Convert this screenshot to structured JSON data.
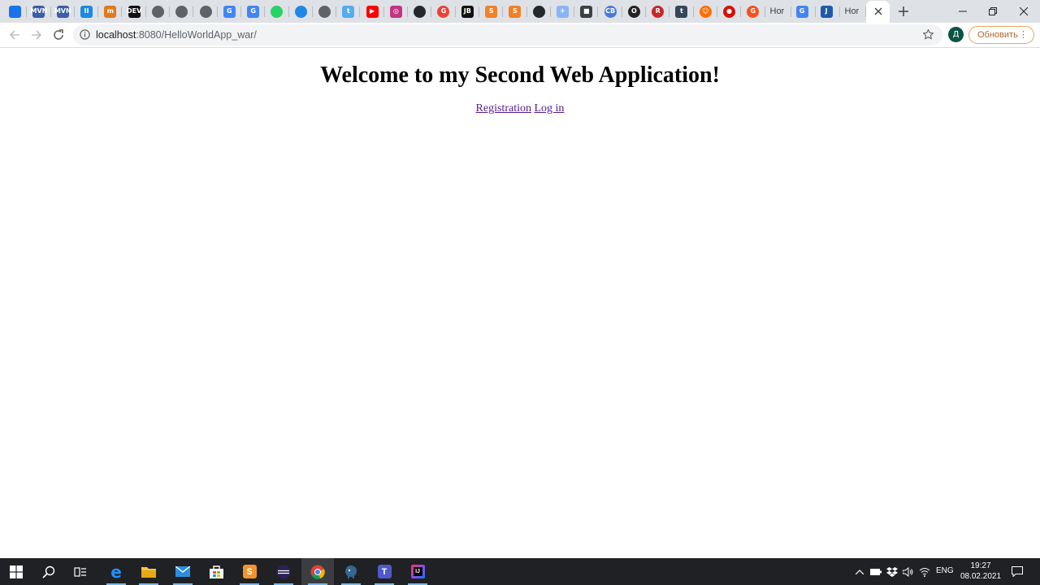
{
  "pinned_tabs": [
    {
      "name": "chat",
      "glyph": "",
      "color": "#1a73e8",
      "round": false
    },
    {
      "name": "mvn",
      "glyph": "MVN",
      "color": "#3b5ea8",
      "round": false
    },
    {
      "name": "mvn-2",
      "glyph": "MVN",
      "color": "#3b5ea8",
      "round": false
    },
    {
      "name": "tabs",
      "glyph": "II",
      "color": "#1e88e5",
      "round": false
    },
    {
      "name": "home",
      "glyph": "m",
      "color": "#e07a1f",
      "round": false
    },
    {
      "name": "dev",
      "glyph": "DEV",
      "color": "#111111",
      "round": false
    },
    {
      "name": "globe",
      "glyph": "",
      "color": "#5f6368",
      "round": true
    },
    {
      "name": "globe-2",
      "glyph": "",
      "color": "#5f6368",
      "round": true
    },
    {
      "name": "globe-3",
      "glyph": "",
      "color": "#5f6368",
      "round": true
    },
    {
      "name": "translate",
      "glyph": "G",
      "color": "#4285f4",
      "round": false
    },
    {
      "name": "translate-2",
      "glyph": "G",
      "color": "#4285f4",
      "round": false
    },
    {
      "name": "whatsapp",
      "glyph": "",
      "color": "#25d366",
      "round": true
    },
    {
      "name": "messenger",
      "glyph": "",
      "color": "#1e88e5",
      "round": true
    },
    {
      "name": "globe-4",
      "glyph": "",
      "color": "#5f6368",
      "round": true
    },
    {
      "name": "twitter",
      "glyph": "t",
      "color": "#55acee",
      "round": false
    },
    {
      "name": "youtube",
      "glyph": "▶",
      "color": "#ff0000",
      "round": false
    },
    {
      "name": "instagram",
      "glyph": "◎",
      "color": "#c13584",
      "round": false
    },
    {
      "name": "github",
      "glyph": "",
      "color": "#24292e",
      "round": true
    },
    {
      "name": "google",
      "glyph": "G",
      "color": "#ea4335",
      "round": true
    },
    {
      "name": "jb",
      "glyph": "JB",
      "color": "#111111",
      "round": false
    },
    {
      "name": "stackoverflow",
      "glyph": "S",
      "color": "#f48024",
      "round": false
    },
    {
      "name": "stackoverflow-2",
      "glyph": "S",
      "color": "#f48024",
      "round": false
    },
    {
      "name": "github-2",
      "glyph": "",
      "color": "#24292e",
      "round": true
    },
    {
      "name": "doc",
      "glyph": "✈",
      "color": "#8ab4f8",
      "round": false
    },
    {
      "name": "bus",
      "glyph": "■",
      "color": "#3c4043",
      "round": false
    },
    {
      "name": "cb",
      "glyph": "CB",
      "color": "#4a79d9",
      "round": true
    },
    {
      "name": "opera",
      "glyph": "O",
      "color": "#222222",
      "round": true
    },
    {
      "name": "red",
      "glyph": "R",
      "color": "#c62828",
      "round": true
    },
    {
      "name": "tumblr",
      "glyph": "t",
      "color": "#35465c",
      "round": false
    },
    {
      "name": "reddit",
      "glyph": "☺",
      "color": "#ff6d00",
      "round": true
    },
    {
      "name": "lastfm",
      "glyph": "●",
      "color": "#d51007",
      "round": true
    },
    {
      "name": "orange",
      "glyph": "G",
      "color": "#f4511e",
      "round": true
    }
  ],
  "text_tabs": [
    {
      "name": "tab-hor",
      "icon": "",
      "icon_color": "",
      "title": "Hor"
    },
    {
      "name": "tab-google",
      "icon": "G",
      "icon_color": "#4285f4",
      "title": ""
    },
    {
      "name": "tab-app",
      "icon": "J",
      "icon_color": "#1e5aa8",
      "title": ""
    },
    {
      "name": "tab-hor-2",
      "icon": "",
      "icon_color": "",
      "title": "Hor"
    }
  ],
  "address_bar": {
    "url_host": "localhost",
    "url_rest": ":8080/HelloWorldApp_war/"
  },
  "profile": {
    "initial": "Д"
  },
  "update_button": {
    "label": "Обновить"
  },
  "page": {
    "heading": "Welcome to my Second Web Application!",
    "links": [
      "Registration",
      "Log in"
    ]
  },
  "taskbar": {
    "language": "ENG",
    "time": "19:27",
    "date": "08.02.2021"
  }
}
